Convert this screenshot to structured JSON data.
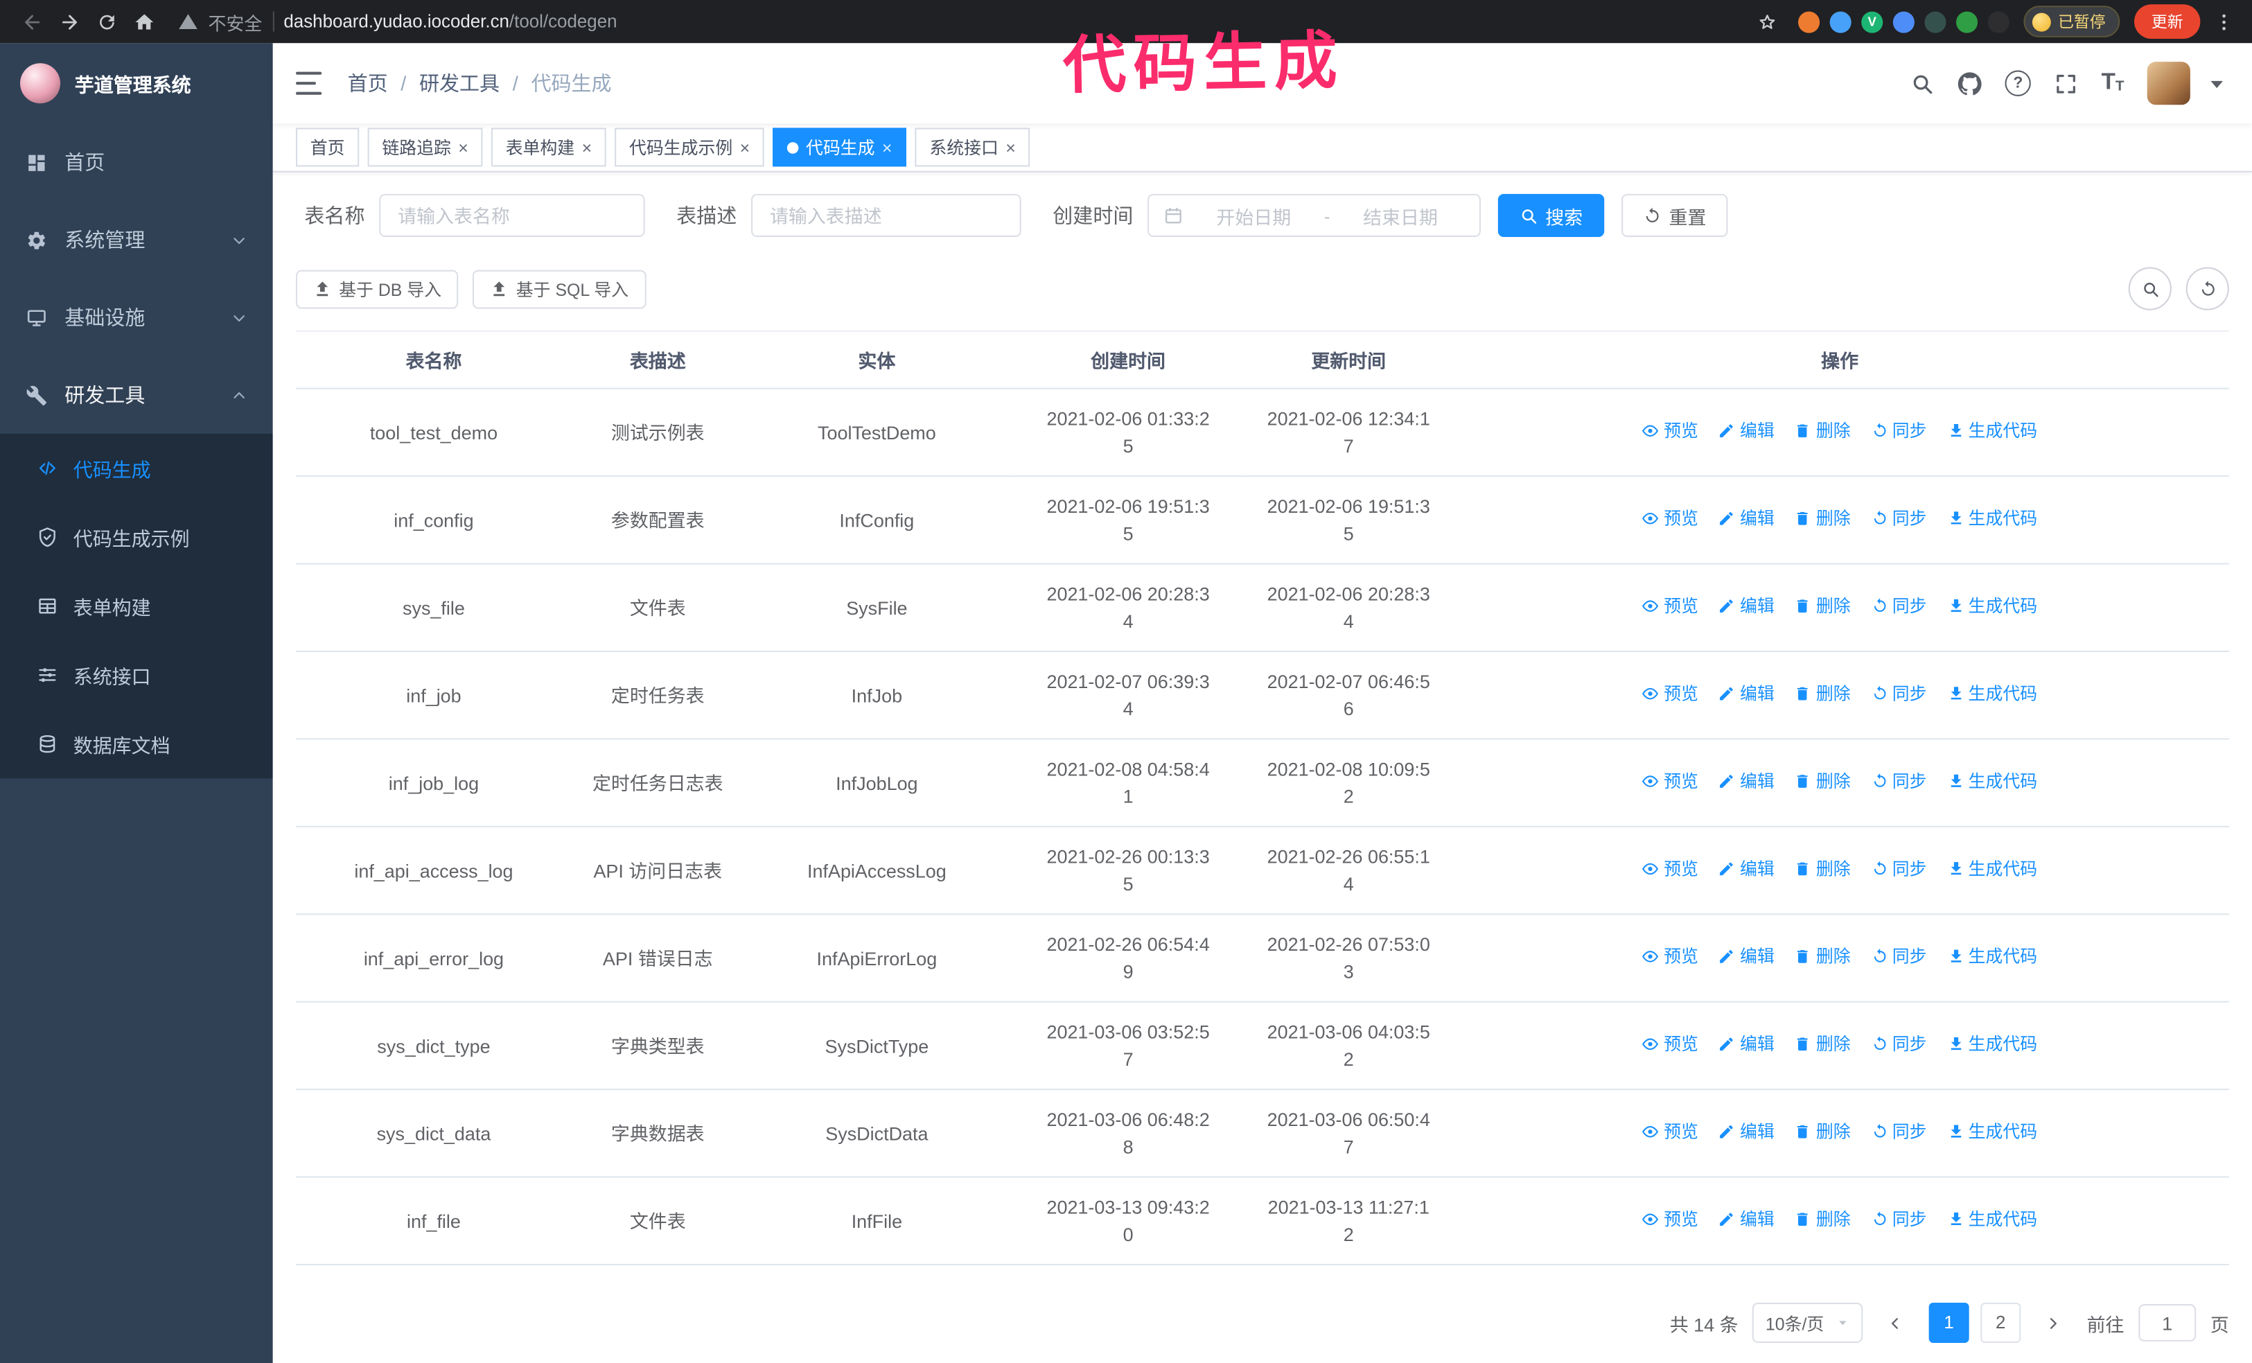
{
  "colors": {
    "accent": "#1890ff",
    "sidebar-bg": "#304156",
    "submenu-bg": "#1f2d3d",
    "annotation": "#fb2c6c"
  },
  "annotation": {
    "text": "代码生成"
  },
  "browser": {
    "security_label": "不安全",
    "url_host": "dashboard.yudao.iocoder.cn",
    "url_path": "/tool/codegen",
    "paused_badge": "已暂停",
    "update_label": "更新",
    "extensions": [
      {
        "name": "fox-extension",
        "color": "#ee7c30",
        "glyph": ""
      },
      {
        "name": "droplet-extension",
        "color": "#48a1f8",
        "glyph": ""
      },
      {
        "name": "vue-devtools-extension",
        "color": "#1db573",
        "glyph": "V"
      },
      {
        "name": "people-extension",
        "color": "#4e8df7",
        "glyph": ""
      },
      {
        "name": "slate-extension",
        "color": "#35514d",
        "glyph": ""
      },
      {
        "name": "leaf-extension",
        "color": "#2f9e44",
        "glyph": ""
      },
      {
        "name": "paw-extension",
        "color": "#2e2e30",
        "glyph": ""
      }
    ]
  },
  "sidebar": {
    "logo_title": "芋道管理系统",
    "items": [
      {
        "id": "home",
        "label": "首页",
        "icon": "grid"
      },
      {
        "id": "system",
        "label": "系统管理",
        "icon": "gear",
        "chevron": "down"
      },
      {
        "id": "infra",
        "label": "基础设施",
        "icon": "monitor",
        "chevron": "down"
      },
      {
        "id": "devtools",
        "label": "研发工具",
        "icon": "tool",
        "chevron": "up",
        "expanded": true
      }
    ],
    "subitems": [
      {
        "id": "codegen",
        "label": "代码生成",
        "icon": "code",
        "active": true
      },
      {
        "id": "codegen-example",
        "label": "代码生成示例",
        "icon": "shield"
      },
      {
        "id": "form-builder",
        "label": "表单构建",
        "icon": "table"
      },
      {
        "id": "api",
        "label": "系统接口",
        "icon": "sliders"
      },
      {
        "id": "db-doc",
        "label": "数据库文档",
        "icon": "db"
      }
    ]
  },
  "header": {
    "breadcrumb": [
      "首页",
      "研发工具",
      "代码生成"
    ]
  },
  "tabs": [
    {
      "id": "home",
      "label": "首页",
      "closable": false
    },
    {
      "id": "trace",
      "label": "链路追踪",
      "closable": true
    },
    {
      "id": "form-builder",
      "label": "表单构建",
      "closable": true
    },
    {
      "id": "codegen-example",
      "label": "代码生成示例",
      "closable": true
    },
    {
      "id": "codegen",
      "label": "代码生成",
      "closable": true,
      "active": true
    },
    {
      "id": "api",
      "label": "系统接口",
      "closable": true
    }
  ],
  "filters": {
    "table_name_label": "表名称",
    "table_name_placeholder": "请输入表名称",
    "table_desc_label": "表描述",
    "table_desc_placeholder": "请输入表描述",
    "create_time_label": "创建时间",
    "date_start_placeholder": "开始日期",
    "date_separator": "-",
    "date_end_placeholder": "结束日期",
    "search_label": "搜索",
    "reset_label": "重置"
  },
  "toolbar": {
    "import_db_label": "基于 DB 导入",
    "import_sql_label": "基于 SQL 导入"
  },
  "table": {
    "columns": [
      "表名称",
      "表描述",
      "实体",
      "创建时间",
      "更新时间",
      "操作"
    ],
    "actions": [
      "预览",
      "编辑",
      "删除",
      "同步",
      "生成代码"
    ],
    "action_ids": [
      "preview",
      "edit",
      "delete",
      "sync",
      "generate-code"
    ],
    "action_icons": [
      "eye",
      "edit",
      "trash",
      "sync",
      "download"
    ],
    "rows": [
      {
        "name": "tool_test_demo",
        "desc": "测试示例表",
        "entity": "ToolTestDemo",
        "created": "2021-02-06 01:33:25",
        "updated": "2021-02-06 12:34:17"
      },
      {
        "name": "inf_config",
        "desc": "参数配置表",
        "entity": "InfConfig",
        "created": "2021-02-06 19:51:35",
        "updated": "2021-02-06 19:51:35"
      },
      {
        "name": "sys_file",
        "desc": "文件表",
        "entity": "SysFile",
        "created": "2021-02-06 20:28:34",
        "updated": "2021-02-06 20:28:34"
      },
      {
        "name": "inf_job",
        "desc": "定时任务表",
        "entity": "InfJob",
        "created": "2021-02-07 06:39:34",
        "updated": "2021-02-07 06:46:56"
      },
      {
        "name": "inf_job_log",
        "desc": "定时任务日志表",
        "entity": "InfJobLog",
        "created": "2021-02-08 04:58:41",
        "updated": "2021-02-08 10:09:52"
      },
      {
        "name": "inf_api_access_log",
        "desc": "API 访问日志表",
        "entity": "InfApiAccessLog",
        "created": "2021-02-26 00:13:35",
        "updated": "2021-02-26 06:55:14"
      },
      {
        "name": "inf_api_error_log",
        "desc": "API 错误日志",
        "entity": "InfApiErrorLog",
        "created": "2021-02-26 06:54:49",
        "updated": "2021-02-26 07:53:03"
      },
      {
        "name": "sys_dict_type",
        "desc": "字典类型表",
        "entity": "SysDictType",
        "created": "2021-03-06 03:52:57",
        "updated": "2021-03-06 04:03:52"
      },
      {
        "name": "sys_dict_data",
        "desc": "字典数据表",
        "entity": "SysDictData",
        "created": "2021-03-06 06:48:28",
        "updated": "2021-03-06 06:50:47"
      },
      {
        "name": "inf_file",
        "desc": "文件表",
        "entity": "InfFile",
        "created": "2021-03-13 09:43:20",
        "updated": "2021-03-13 11:27:12"
      }
    ]
  },
  "pagination": {
    "total": "共 14 条",
    "page_size": "10条/页",
    "pages": [
      "1",
      "2"
    ],
    "active_page": "1",
    "goto_label": "前往",
    "goto_value": "1",
    "page_unit": "页"
  }
}
